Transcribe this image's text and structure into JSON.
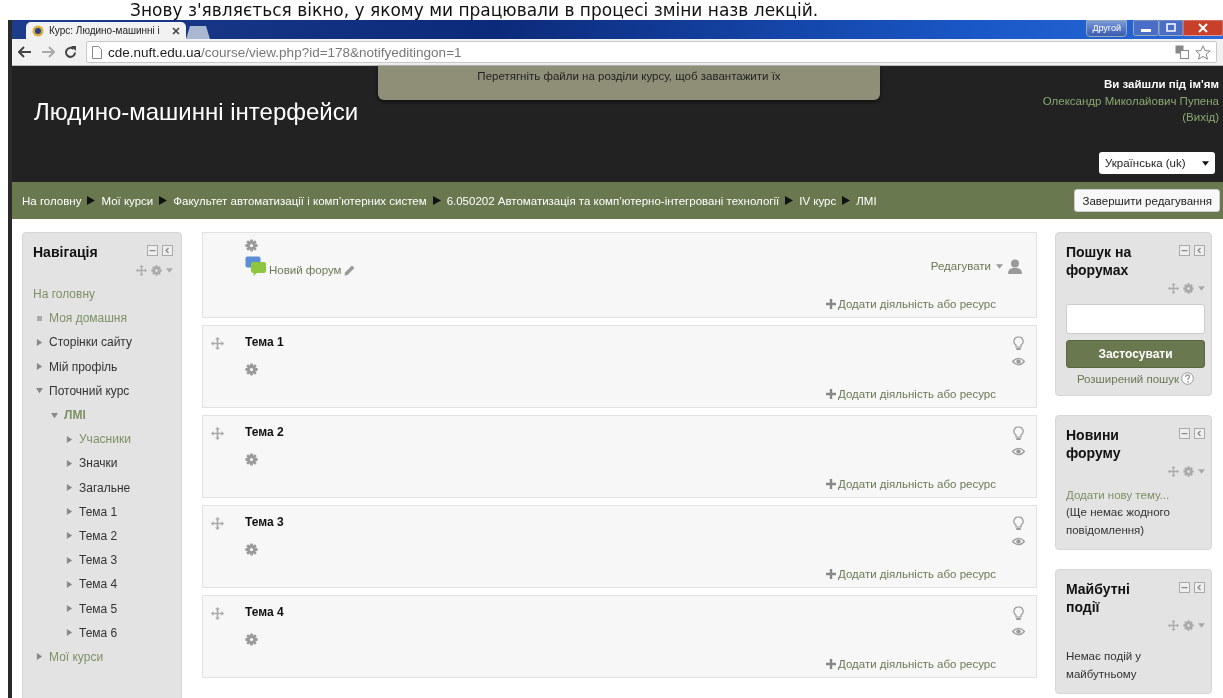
{
  "caption": "Знову з'являється вікно, у якому ми працювали в процесі зміни назв лекцій.",
  "browser": {
    "tab_title": "Курс: Людино-машинні і",
    "profile_button": "Другой",
    "url_host": "cde.nuft.edu.ua",
    "url_path": "/course/view.php?id=178&notifyeditingon=1"
  },
  "header": {
    "site_title": "Людино-машинні інтерфейси",
    "drop_notice": "Перетягніть файли на розділи курсу, щоб завантажити їх",
    "login_prefix": "Ви зайшли під ім'ям",
    "user_name": "Олександр Миколайович Пупена",
    "logout_link": "(Вихід)",
    "language": "Українська (uk)"
  },
  "breadcrumb": [
    "На головну",
    "Мої курси",
    "Факультет автоматизації і комп’ютерних систем",
    "6.050202 Автоматизація та комп’ютерно-інтегровані технології",
    "IV курс",
    "ЛМІ"
  ],
  "edit_button": "Завершити редагування",
  "navigation": {
    "title": "Навігація",
    "items": [
      {
        "label": "На головну",
        "kind": "plain",
        "linked": true
      },
      {
        "label": "Моя домашня",
        "kind": "bullet",
        "linked": true
      },
      {
        "label": "Сторінки сайту",
        "kind": "branch",
        "linked": false,
        "expanded": false
      },
      {
        "label": "Мій профіль",
        "kind": "branch",
        "linked": false,
        "expanded": false
      },
      {
        "label": "Поточний курс",
        "kind": "branch",
        "linked": false,
        "expanded": true,
        "children": [
          {
            "label": "ЛМІ",
            "kind": "course",
            "linked": true,
            "expanded": true,
            "children": [
              {
                "label": "Учасники",
                "kind": "branch",
                "linked": true,
                "expanded": false
              },
              {
                "label": "Значки",
                "kind": "branch",
                "linked": false,
                "expanded": false
              },
              {
                "label": "Загальне",
                "kind": "branch",
                "linked": false,
                "expanded": false
              },
              {
                "label": "Тема 1",
                "kind": "branch",
                "linked": false,
                "expanded": false
              },
              {
                "label": "Тема 2",
                "kind": "branch",
                "linked": false,
                "expanded": false
              },
              {
                "label": "Тема 3",
                "kind": "branch",
                "linked": false,
                "expanded": false
              },
              {
                "label": "Тема 4",
                "kind": "branch",
                "linked": false,
                "expanded": false
              },
              {
                "label": "Тема 5",
                "kind": "branch",
                "linked": false,
                "expanded": false
              },
              {
                "label": "Тема 6",
                "kind": "branch",
                "linked": false,
                "expanded": false
              }
            ]
          }
        ]
      },
      {
        "label": "Мої курси",
        "kind": "branch",
        "linked": true,
        "expanded": false
      }
    ]
  },
  "sections": [
    {
      "kind": "intro",
      "activity": "Новий форум",
      "edit_menu": "Редагувати",
      "add_link": "Додати діяльність або ресурс"
    },
    {
      "kind": "topic",
      "title": "Тема 1",
      "add_link": "Додати діяльність або ресурс"
    },
    {
      "kind": "topic",
      "title": "Тема 2",
      "add_link": "Додати діяльність або ресурс"
    },
    {
      "kind": "topic",
      "title": "Тема 3",
      "add_link": "Додати діяльність або ресурс"
    },
    {
      "kind": "topic",
      "title": "Тема 4",
      "add_link": "Додати діяльність або ресурс"
    }
  ],
  "blocks": [
    {
      "kind": "search",
      "title": "Пошук на форумах",
      "button": "Застосувати",
      "link": "Розширений пошук"
    },
    {
      "kind": "news",
      "title": "Новини форуму",
      "link": "Додати нову тему...",
      "text": "(Ще немає жодного повідомлення)"
    },
    {
      "kind": "events",
      "title": "Майбутні події",
      "text": "Немає подій у майбутньому"
    }
  ]
}
